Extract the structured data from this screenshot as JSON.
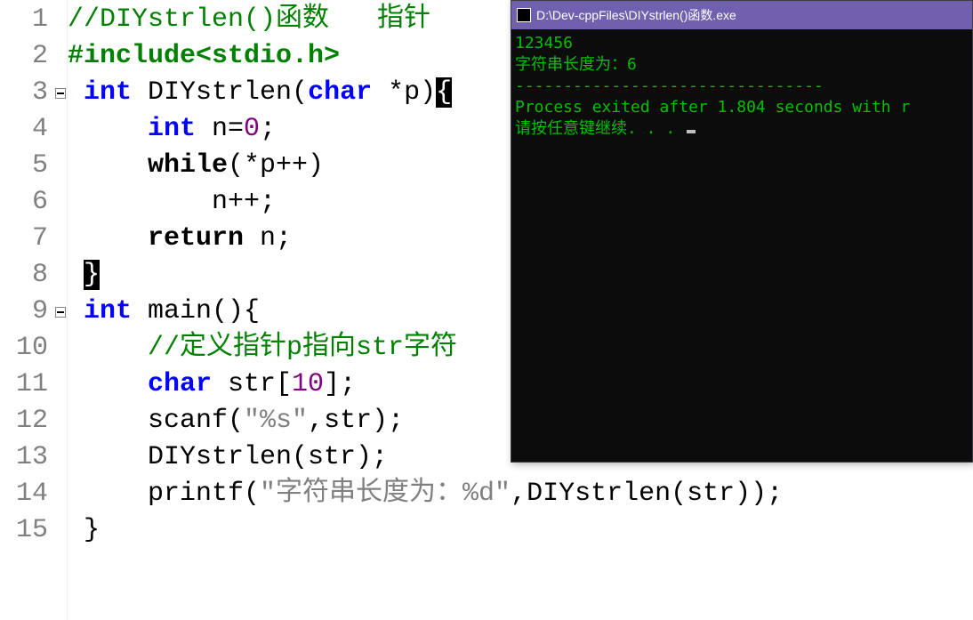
{
  "editor": {
    "lines": [
      {
        "n": "1",
        "html": "<span class='comment'>//DIYstrlen()函数   指针</span>"
      },
      {
        "n": "2",
        "html": "<span class='pre'>#include&lt;stdio.h&gt;</span>"
      },
      {
        "n": "3",
        "fold": true,
        "html": " <span class='type'>int</span> DIYstrlen(<span class='type'>char</span> *p)<span class='cursor-block'>{</span>"
      },
      {
        "n": "4",
        "html": "     <span class='type'>int</span> n=<span class='num'>0</span>;"
      },
      {
        "n": "5",
        "html": "     <span class='keyword'>while</span>(*p++)"
      },
      {
        "n": "6",
        "html": "         n++;"
      },
      {
        "n": "7",
        "html": "     <span class='keyword'>return</span> n;"
      },
      {
        "n": "8",
        "html": " <span class='cursor-block'>}</span>"
      },
      {
        "n": "9",
        "fold": true,
        "html": " <span class='type'>int</span> main(){"
      },
      {
        "n": "10",
        "html": "     <span class='comment'>//定义指针p指向str字符</span>"
      },
      {
        "n": "11",
        "html": "     <span class='type'>char</span> str[<span class='num'>10</span>];"
      },
      {
        "n": "12",
        "html": "     scanf(<span class='string'>\"%s\"</span>,str);"
      },
      {
        "n": "13",
        "html": "     DIYstrlen(str);"
      },
      {
        "n": "14",
        "html": "     printf(<span class='string'>\"字符串长度为：%d\"</span>,DIYstrlen(str));"
      },
      {
        "n": "15",
        "html": " }"
      }
    ]
  },
  "console": {
    "title": "D:\\Dev-cppFiles\\DIYstrlen()函数.exe",
    "lines": [
      "123456",
      "字符串长度为：6",
      "--------------------------------",
      "Process exited after 1.804 seconds with r",
      "请按任意键继续. . . "
    ]
  }
}
